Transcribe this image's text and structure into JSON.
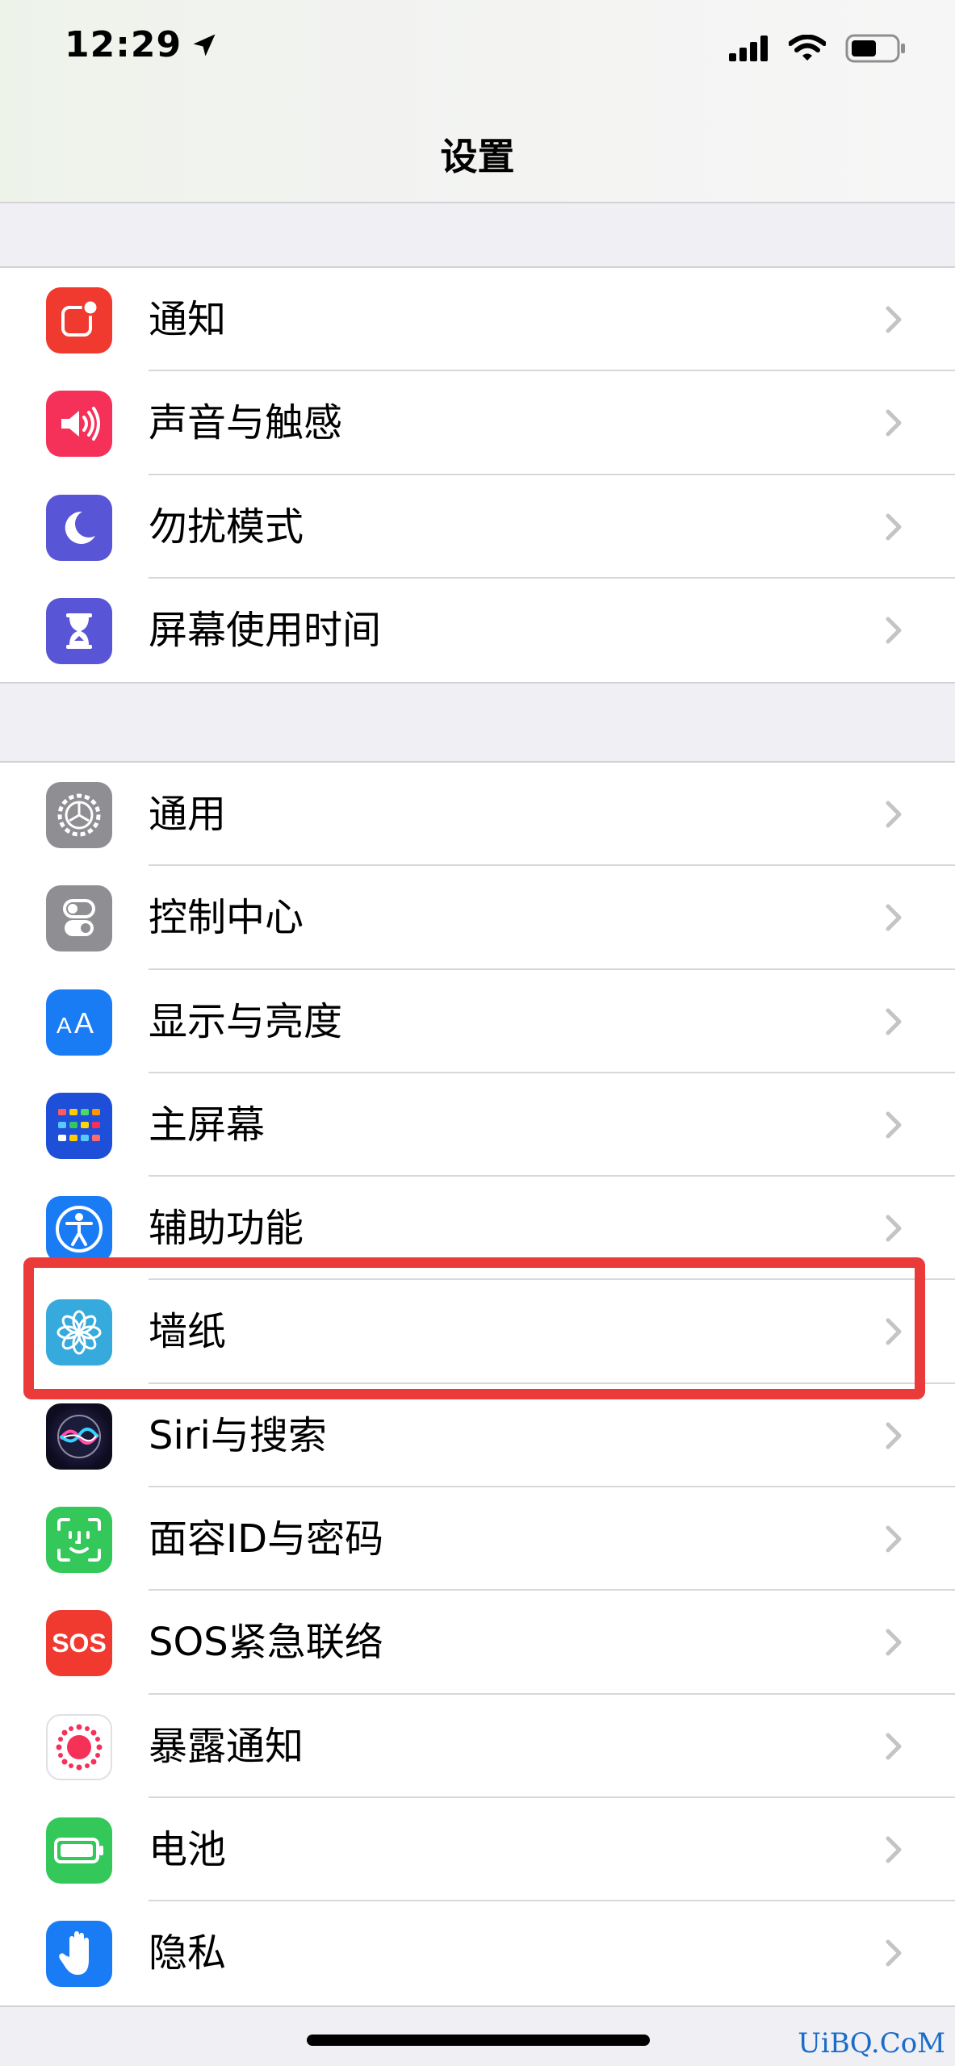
{
  "status_bar": {
    "time": "12:29",
    "icons": [
      "location-arrow-icon",
      "cellular-signal-icon",
      "wifi-icon",
      "battery-icon"
    ]
  },
  "nav": {
    "title": "设置"
  },
  "group1": [
    {
      "label": "通知",
      "icon": "notifications-icon",
      "color": "#f03a30"
    },
    {
      "label": "声音与触感",
      "icon": "sound-icon",
      "color": "#f5315a"
    },
    {
      "label": "勿扰模式",
      "icon": "moon-icon",
      "color": "#5856d6"
    },
    {
      "label": "屏幕使用时间",
      "icon": "hourglass-icon",
      "color": "#5856d6"
    }
  ],
  "group2": [
    {
      "label": "通用",
      "icon": "gear-icon",
      "color": "#8e8e93"
    },
    {
      "label": "控制中心",
      "icon": "toggles-icon",
      "color": "#8e8e93"
    },
    {
      "label": "显示与亮度",
      "icon": "text-size-icon",
      "color": "#1a7cf5"
    },
    {
      "label": "主屏幕",
      "icon": "home-grid-icon",
      "color": "#1e4fd8"
    },
    {
      "label": "辅助功能",
      "icon": "accessibility-icon",
      "color": "#1a7cf5"
    },
    {
      "label": "墙纸",
      "icon": "flower-icon",
      "color": "#36aadc"
    },
    {
      "label": "Siri与搜索",
      "icon": "siri-icon",
      "color": "#1c1c3a"
    },
    {
      "label": "面容ID与密码",
      "icon": "face-id-icon",
      "color": "#34c759"
    },
    {
      "label": "SOS紧急联络",
      "icon": "sos-icon",
      "color": "#f03a30",
      "icon_text": "SOS"
    },
    {
      "label": "暴露通知",
      "icon": "exposure-icon",
      "color": "#ffffff"
    },
    {
      "label": "电池",
      "icon": "battery-green-icon",
      "color": "#34c759"
    },
    {
      "label": "隐私",
      "icon": "hand-icon",
      "color": "#1a7cf5"
    }
  ],
  "highlighted_item": "墙纸",
  "watermark": "UiBQ.CoM"
}
